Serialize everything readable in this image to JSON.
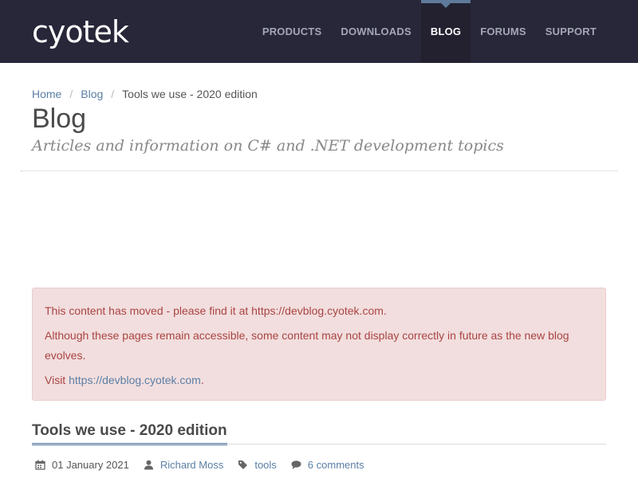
{
  "header": {
    "logo": "cyotek",
    "nav": [
      {
        "label": "PRODUCTS"
      },
      {
        "label": "DOWNLOADS"
      },
      {
        "label": "BLOG",
        "active": true
      },
      {
        "label": "FORUMS"
      },
      {
        "label": "SUPPORT"
      }
    ]
  },
  "breadcrumb": {
    "items": [
      "Home",
      "Blog"
    ],
    "current": "Tools we use - 2020 edition"
  },
  "page": {
    "title": "Blog",
    "subtitle": "Articles and information on C# and .NET development topics"
  },
  "alert": {
    "line1": "This content has moved - please find it at https://devblog.cyotek.com.",
    "line2": "Although these pages remain accessible, some content may not display correctly in future as the new blog evolves.",
    "visit_prefix": "Visit ",
    "visit_link": "https://devblog.cyotek.com",
    "visit_suffix": "."
  },
  "post": {
    "title": "Tools we use - 2020 edition",
    "date": "01 January 2021",
    "author": "Richard Moss",
    "tag": "tools",
    "comments": "6 comments"
  },
  "colors": {
    "header_bg": "#282639",
    "accent": "#5b7fa6",
    "alert_bg": "#f2dede",
    "alert_text": "#a94442"
  },
  "icons": [
    "calendar-icon",
    "user-icon",
    "tag-icon",
    "comment-icon"
  ]
}
